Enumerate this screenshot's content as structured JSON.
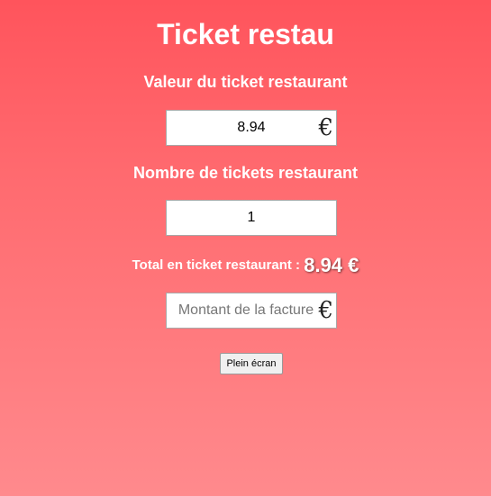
{
  "app": {
    "title": "Ticket restau"
  },
  "ticket_value": {
    "label": "Valeur du ticket restaurant",
    "value": "8.94",
    "currency_symbol": "€"
  },
  "ticket_count": {
    "label": "Nombre de tickets restaurant",
    "value": "1"
  },
  "total": {
    "label": "Total en ticket restaurant : ",
    "value": "8.94 €"
  },
  "invoice": {
    "value": "",
    "placeholder": "Montant de la facture",
    "currency_symbol": "€"
  },
  "actions": {
    "fullscreen_label": "Plein écran"
  },
  "colors": {
    "background_top": "#ff545c",
    "background_bottom": "#ff8a8d",
    "text": "#ffffff"
  }
}
